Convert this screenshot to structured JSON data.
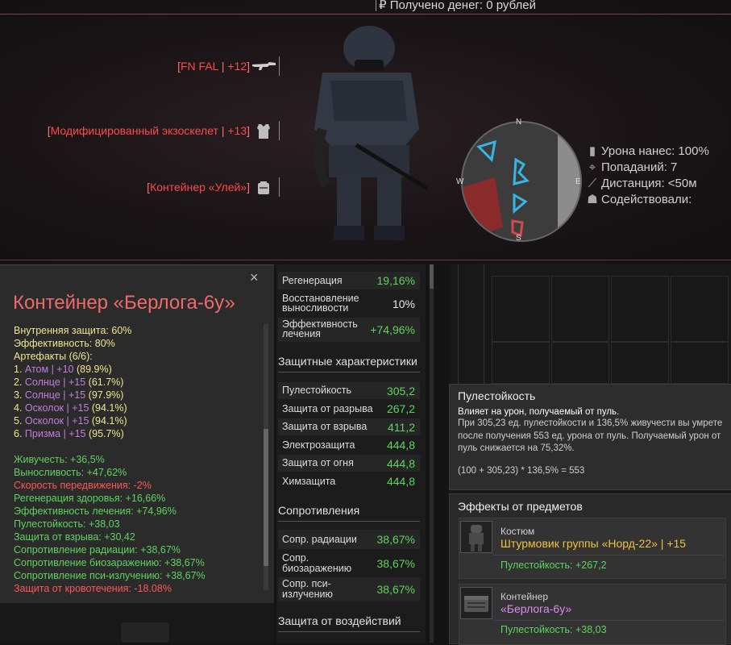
{
  "top": {
    "money": "Получено денег: 0 рублей",
    "slots": [
      {
        "label": "FN FAL",
        "level": "+12",
        "icon": "rifle-icon"
      },
      {
        "label": "Модифицированный экзоскелет",
        "level": "+13",
        "icon": "armor-icon"
      },
      {
        "label": "Контейнер «Улей»",
        "level": "",
        "icon": "backpack-icon"
      }
    ],
    "minimap": {
      "n": "N",
      "e": "E",
      "w": "W",
      "s": "S"
    },
    "combat": [
      {
        "icon": "bullet-icon",
        "text": "Урона нанес: 100%"
      },
      {
        "icon": "crosshair-icon",
        "text": "Попаданий: 7"
      },
      {
        "icon": "ruler-icon",
        "text": "Дистанция: <50м"
      },
      {
        "icon": "group-icon",
        "text": "Содействовали:"
      }
    ]
  },
  "left_panel": {
    "title": "Контейнер «Берлога-6у»",
    "close": "×",
    "lines": [
      {
        "c": "y",
        "t": "Внутренняя защита: 60%"
      },
      {
        "c": "y",
        "t": "Эффективность: 80%"
      },
      {
        "c": "y",
        "t": "Артефакты (6/6):"
      },
      {
        "c": "y",
        "t": "1. ",
        "a": "Атом | +10",
        "ac": "p",
        "b": " (89.9%)"
      },
      {
        "c": "y",
        "t": "2. ",
        "a": "Солнце | +15",
        "ac": "p",
        "b": " (61.7%)"
      },
      {
        "c": "y",
        "t": "3. ",
        "a": "Солнце | +15",
        "ac": "p",
        "b": " (97.9%)"
      },
      {
        "c": "y",
        "t": "4. ",
        "a": "Осколок | +15",
        "ac": "p",
        "b": " (94.1%)"
      },
      {
        "c": "y",
        "t": "5. ",
        "a": "Осколок | +15",
        "ac": "p",
        "b": " (94.1%)"
      },
      {
        "c": "y",
        "t": "6. ",
        "a": "Призма | +15",
        "ac": "p",
        "b": " (95.7%)"
      },
      {
        "c": "",
        "t": ""
      },
      {
        "c": "g",
        "t": "Живучесть: +36,5%"
      },
      {
        "c": "g",
        "t": "Выносливость: +47,62%"
      },
      {
        "c": "r",
        "t": "Скорость передвижения: -2%"
      },
      {
        "c": "g",
        "t": "Регенерация здоровья: +16,66%"
      },
      {
        "c": "g",
        "t": "Эффективность лечения: +74,96%"
      },
      {
        "c": "g",
        "t": "Пулестойкость: +38,03"
      },
      {
        "c": "g",
        "t": "Защита от взрыва: +30,42"
      },
      {
        "c": "g",
        "t": "Сопротивление радиации: +38,67%"
      },
      {
        "c": "g",
        "t": "Сопротивление биозаражению: +38,67%"
      },
      {
        "c": "g",
        "t": "Сопротивление пси-излучению: +38,67%"
      },
      {
        "c": "r",
        "t": "Защита от кровотечения: -18.08%"
      }
    ]
  },
  "mid": {
    "top_rows": [
      {
        "label": "Регенерация",
        "value": "19,16%",
        "white": false
      },
      {
        "label": "Восстановление выносливости",
        "value": "10%",
        "white": true
      },
      {
        "label": "Эффективность лечения",
        "value": "+74,96%",
        "white": false
      }
    ],
    "protect_title": "Защитные характеристики",
    "protect_rows": [
      {
        "label": "Пулестойкость",
        "value": "305,2"
      },
      {
        "label": "Защита от разрыва",
        "value": "267,2"
      },
      {
        "label": "Защита от взрыва",
        "value": "411,2"
      },
      {
        "label": "Электрозащита",
        "value": "444,8"
      },
      {
        "label": "Защита от огня",
        "value": "444,8"
      },
      {
        "label": "Химзащита",
        "value": "444,8"
      }
    ],
    "resist_title": "Сопротивления",
    "resist_rows": [
      {
        "label": "Сопр. радиации",
        "value": "38,67%"
      },
      {
        "label": "Сопр. биозаражению",
        "value": "38,67%"
      },
      {
        "label": "Сопр. пси-излучению",
        "value": "38,67%"
      }
    ],
    "impact_title": "Защита от воздействий"
  },
  "tooltip": {
    "title": "Пулестойкость",
    "subtitle": "Влияет на урон, получаемый от пуль.",
    "body": "При 305,23 ед. пулестойкости и 136,5% живучести вы умрете после получения 553 ед. урона от пуль. Получаемый урон от пуль снижается на 75,32%.",
    "formula": "(100 + 305,23) * 136,5% = 553"
  },
  "effects": {
    "title": "Эффекты от предметов",
    "items": [
      {
        "type": "Костюм",
        "name": "Штурмовик группы «Норд-22» | +15",
        "name_color": "#f0c23c",
        "value": "Пулестойкость: +267,2"
      },
      {
        "type": "Контейнер",
        "name": "«Берлога-6у»",
        "name_color": "#d88cf0",
        "value": "Пулестойкость: +38,03"
      }
    ]
  }
}
